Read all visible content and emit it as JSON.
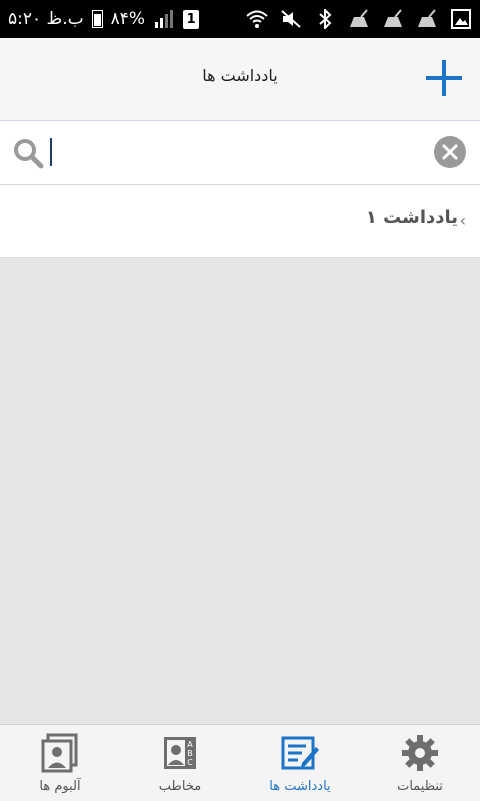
{
  "status_bar": {
    "time": "۵:۲۰ ب.ظ",
    "battery": "۸۴%",
    "sim_slot": "1"
  },
  "header": {
    "title": "یادداشت ها"
  },
  "search": {
    "value": "",
    "placeholder": ""
  },
  "notes": [
    {
      "title": "یادداشت ۱"
    }
  ],
  "bottom_nav": {
    "items": [
      {
        "label": "آلبوم ها",
        "icon": "album-icon"
      },
      {
        "label": "مخاطب",
        "icon": "contact-icon"
      },
      {
        "label": "یادداشت ها",
        "icon": "notes-icon",
        "active": true
      },
      {
        "label": "تنظیمات",
        "icon": "gear-icon"
      }
    ]
  },
  "colors": {
    "accent": "#1b74c8",
    "status_bar": "#000000",
    "header_bg": "#f6f6f6",
    "content_bg": "#e5e5e5"
  }
}
